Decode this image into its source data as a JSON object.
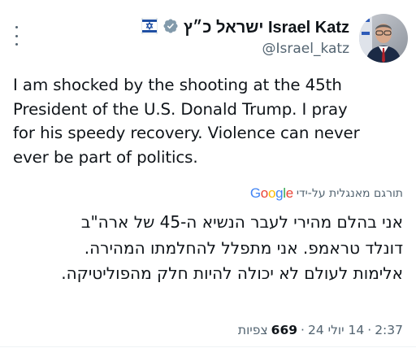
{
  "author": {
    "display_name": "ישראל כ״ץ Israel Katz",
    "handle": "@Israel_katz",
    "verified": true,
    "verified_color": "#829aab"
  },
  "tweet": {
    "text_lines": [
      "I am shocked by the shooting at the 45th",
      "President of the U.S. Donald Trump. I pray",
      "for his speedy recovery. Violence can never",
      "ever be part of politics."
    ]
  },
  "translation": {
    "label": "תורגם מאנגלית על-ידי",
    "provider": "Google",
    "lines": [
      "אני בהלם מהירי לעבר הנשיא ה-45 של ארה\"ב",
      "דונלד טראמפ. אני מתפלל להחלמתו המהירה.",
      "אלימות לעולם לא יכולה להיות חלק מהפוליטיקה."
    ]
  },
  "meta": {
    "time": "2:37",
    "separator": "·",
    "date": "14 יולי 24",
    "views_count": "669",
    "views_label": "צפיות"
  },
  "icons": [
    "more-options-icon",
    "verified-badge-icon",
    "government-org-icon"
  ]
}
